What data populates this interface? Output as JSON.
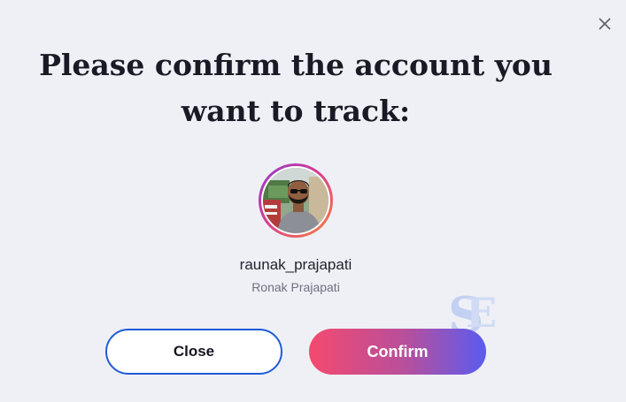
{
  "dialog": {
    "title": "Please confirm the account you want to track:",
    "close_icon": "close-icon"
  },
  "account": {
    "username": "raunak_prajapati",
    "full_name": "Ronak Prajapati",
    "avatar_icon": "profile-photo"
  },
  "buttons": {
    "close_label": "Close",
    "confirm_label": "Confirm"
  },
  "colors": {
    "background": "#eff0f6",
    "close_border": "#1e5bd6",
    "confirm_gradient_start": "#f44a6f",
    "confirm_gradient_end": "#5a5cf0",
    "avatar_ring_start": "#8b3fd0",
    "avatar_ring_end": "#f7843a"
  }
}
